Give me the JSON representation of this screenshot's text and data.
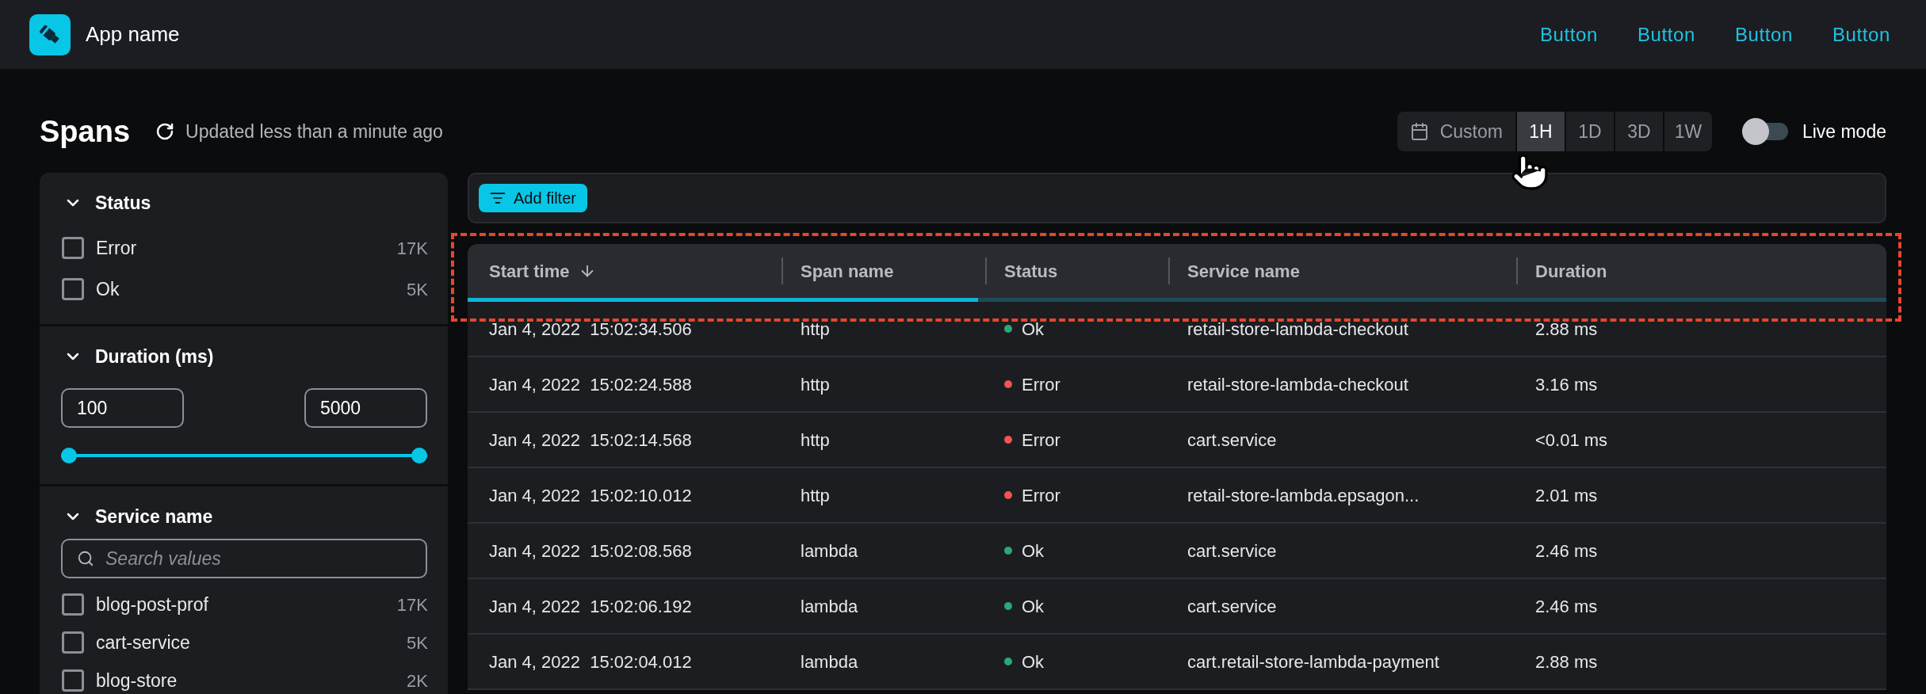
{
  "app": {
    "name": "App name"
  },
  "nav_buttons": [
    "Button",
    "Button",
    "Button",
    "Button"
  ],
  "page": {
    "title": "Spans",
    "updated": "Updated less than a minute ago"
  },
  "time_range": {
    "custom_label": "Custom",
    "options": [
      {
        "label": "1H",
        "selected": true
      },
      {
        "label": "1D",
        "selected": false
      },
      {
        "label": "3D",
        "selected": false
      },
      {
        "label": "1W",
        "selected": false
      }
    ]
  },
  "live_mode": {
    "label": "Live mode",
    "on": false
  },
  "sidebar": {
    "sections": [
      {
        "kind": "checklist",
        "title": "Status",
        "expanded": true,
        "items": [
          {
            "label": "Error",
            "count": "17K",
            "checked": false
          },
          {
            "label": "Ok",
            "count": "5K",
            "checked": false
          }
        ]
      },
      {
        "kind": "range",
        "title": "Duration (ms)",
        "expanded": true,
        "min": "100",
        "max": "5000",
        "level": 1
      },
      {
        "kind": "search_list",
        "title": "Service name",
        "expanded": true,
        "placeholder": "Search values",
        "items": [
          {
            "label": "blog-post-prof",
            "count": "17K",
            "checked": false
          },
          {
            "label": "cart-service",
            "count": "5K",
            "checked": false
          },
          {
            "label": "blog-store",
            "count": "2K",
            "checked": false
          }
        ]
      }
    ]
  },
  "filter_bar": {
    "add_filter": "Add filter"
  },
  "table": {
    "columns": [
      {
        "label": "Start time",
        "sorted": true
      },
      {
        "label": "Span name",
        "sorted": false
      },
      {
        "label": "Status",
        "sorted": false
      },
      {
        "label": "Service name",
        "sorted": false
      },
      {
        "label": "Duration",
        "sorted": false
      }
    ],
    "loading": {
      "level": 0.36
    },
    "rows": [
      {
        "start_time": "Jan 4, 2022  15:02:34.506",
        "span_name": "http",
        "status": "Ok",
        "color": "#2aa876",
        "service": "retail-store-lambda-checkout",
        "duration": "2.88 ms"
      },
      {
        "start_time": "Jan 4, 2022  15:02:24.588",
        "span_name": "http",
        "status": "Error",
        "color": "#f05454",
        "service": "retail-store-lambda-checkout",
        "duration": "3.16 ms"
      },
      {
        "start_time": "Jan 4, 2022  15:02:14.568",
        "span_name": "http",
        "status": "Error",
        "color": "#f05454",
        "service": "cart.service",
        "duration": "<0.01 ms"
      },
      {
        "start_time": "Jan 4, 2022  15:02:10.012",
        "span_name": "http",
        "status": "Error",
        "color": "#f05454",
        "service": "retail-store-lambda.epsagon...",
        "duration": "2.01 ms"
      },
      {
        "start_time": "Jan 4, 2022  15:02:08.568",
        "span_name": "lambda",
        "status": "Ok",
        "color": "#2aa876",
        "service": "cart.service",
        "duration": "2.46 ms"
      },
      {
        "start_time": "Jan 4, 2022  15:02:06.192",
        "span_name": "lambda",
        "status": "Ok",
        "color": "#2aa876",
        "service": "cart.service",
        "duration": "2.46 ms"
      },
      {
        "start_time": "Jan 4, 2022  15:02:04.012",
        "span_name": "lambda",
        "status": "Ok",
        "color": "#2aa876",
        "service": "cart.retail-store-lambda-payment",
        "duration": "2.88 ms"
      }
    ]
  }
}
